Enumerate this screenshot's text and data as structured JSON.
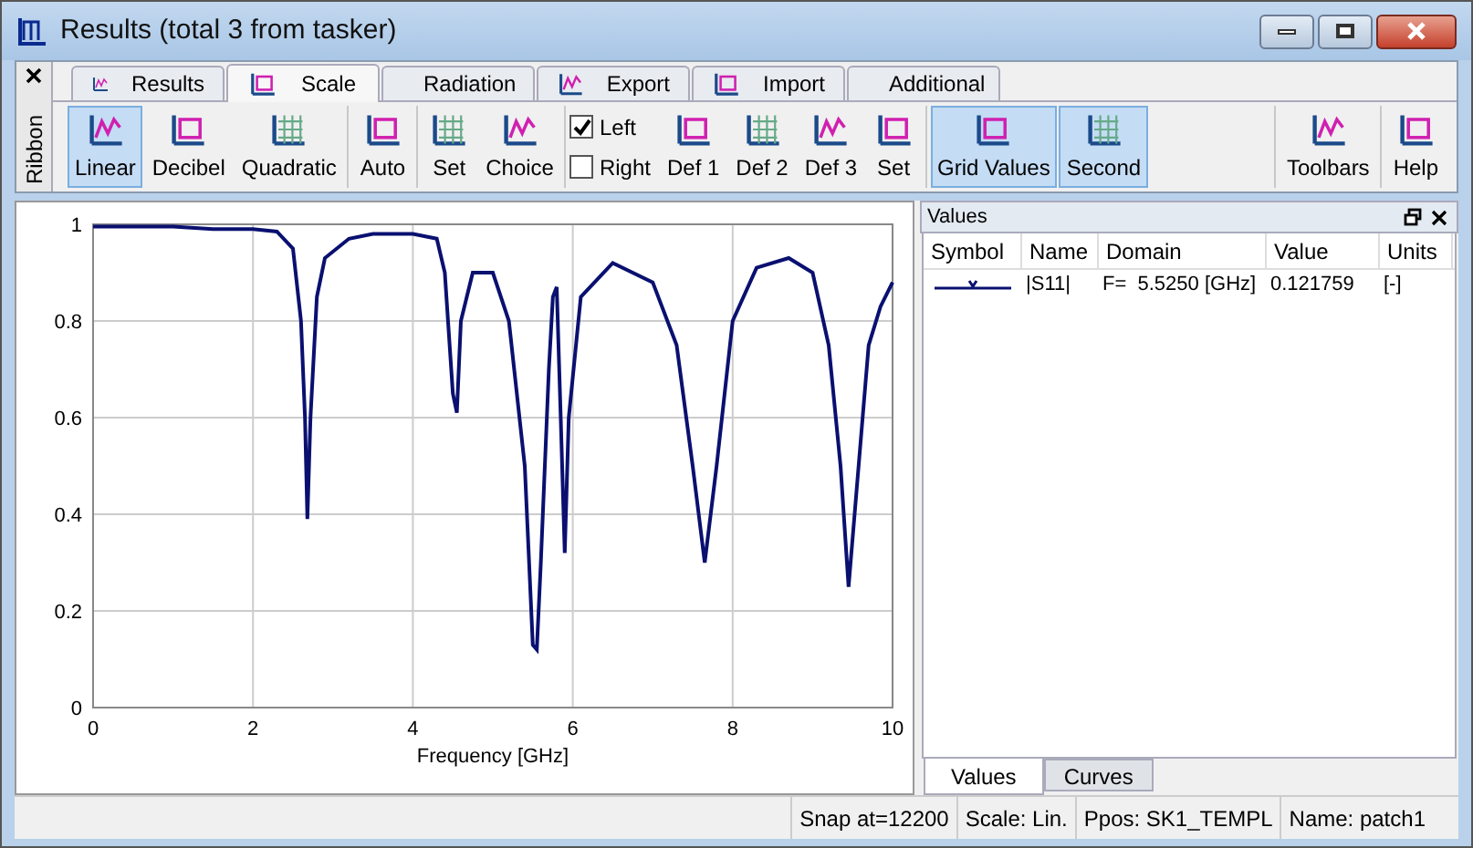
{
  "window": {
    "title": "Results (total 3 from tasker)"
  },
  "ribbon_label": "Ribbon",
  "tabs": [
    {
      "label": "Results",
      "selected": false
    },
    {
      "label": "Scale",
      "selected": true
    },
    {
      "label": "Radiation",
      "selected": false
    },
    {
      "label": "Export",
      "selected": false
    },
    {
      "label": "Import",
      "selected": false
    },
    {
      "label": "Additional",
      "selected": false
    }
  ],
  "ribbon_groups": [
    [
      {
        "kind": "button",
        "label": "Linear",
        "selected": true
      },
      {
        "kind": "button",
        "label": "Decibel",
        "selected": false
      },
      {
        "kind": "button",
        "label": "Quadratic",
        "selected": false
      }
    ],
    [
      {
        "kind": "button",
        "label": "Auto",
        "selected": false
      }
    ],
    [
      {
        "kind": "button",
        "label": "Set",
        "selected": false
      },
      {
        "kind": "button",
        "label": "Choice",
        "selected": false
      }
    ],
    [
      {
        "kind": "checks",
        "items": [
          {
            "label": "Left",
            "checked": true
          },
          {
            "label": "Right",
            "checked": false
          }
        ]
      },
      {
        "kind": "button",
        "label": "Def 1",
        "selected": false
      },
      {
        "kind": "button",
        "label": "Def 2",
        "selected": false
      },
      {
        "kind": "button",
        "label": "Def 3",
        "selected": false
      },
      {
        "kind": "button",
        "label": "Set",
        "selected": false
      }
    ],
    [
      {
        "kind": "button",
        "label": "Grid Values",
        "selected": true
      },
      {
        "kind": "button",
        "label": "Second",
        "selected": true
      }
    ],
    [
      {
        "kind": "spacer"
      }
    ],
    [
      {
        "kind": "button",
        "label": "Toolbars",
        "selected": false
      }
    ],
    [
      {
        "kind": "button",
        "label": "Help",
        "selected": false
      }
    ]
  ],
  "chart_data": {
    "type": "line",
    "grid": true,
    "xlabel": "Frequency [GHz]",
    "xlim": [
      0,
      10
    ],
    "ylim": [
      0,
      1
    ],
    "xticks": [
      0,
      2,
      4,
      6,
      8,
      10
    ],
    "yticks": [
      0,
      0.2,
      0.4,
      0.6,
      0.8,
      1
    ],
    "x": [
      0,
      0.5,
      1,
      1.5,
      2,
      2.3,
      2.5,
      2.6,
      2.65,
      2.68,
      2.72,
      2.8,
      2.9,
      3.2,
      3.5,
      4,
      4.3,
      4.4,
      4.5,
      4.55,
      4.6,
      4.75,
      5,
      5.2,
      5.4,
      5.5,
      5.55,
      5.6,
      5.7,
      5.75,
      5.8,
      5.85,
      5.9,
      5.95,
      6.1,
      6.5,
      7,
      7.3,
      7.5,
      7.65,
      7.8,
      8,
      8.3,
      8.7,
      9,
      9.2,
      9.35,
      9.45,
      9.55,
      9.7,
      9.85,
      10
    ],
    "series": [
      {
        "name": "|S11|",
        "color": "#0a1070",
        "values": [
          0.995,
          0.995,
          0.995,
          0.99,
          0.99,
          0.985,
          0.95,
          0.8,
          0.6,
          0.39,
          0.6,
          0.85,
          0.93,
          0.97,
          0.98,
          0.98,
          0.97,
          0.9,
          0.65,
          0.61,
          0.8,
          0.9,
          0.9,
          0.8,
          0.5,
          0.13,
          0.12,
          0.3,
          0.7,
          0.85,
          0.87,
          0.6,
          0.32,
          0.6,
          0.85,
          0.92,
          0.88,
          0.75,
          0.5,
          0.3,
          0.5,
          0.8,
          0.91,
          0.93,
          0.9,
          0.75,
          0.5,
          0.25,
          0.45,
          0.75,
          0.83,
          0.88
        ]
      }
    ]
  },
  "values_panel": {
    "title": "Values",
    "columns": [
      "Symbol",
      "Name",
      "Domain",
      "Value",
      "Units"
    ],
    "rows": [
      {
        "domain": "F=  5.5250 [GHz]",
        "value": "0.121759",
        "units": "[-]"
      }
    ],
    "tabs": [
      {
        "label": "Values",
        "selected": true
      },
      {
        "label": "Curves",
        "selected": false
      }
    ]
  },
  "status_bar": [
    "Snap at=12200",
    "Scale: Lin.",
    "Ppos: SK1_TEMPL",
    "Name: patch1"
  ]
}
